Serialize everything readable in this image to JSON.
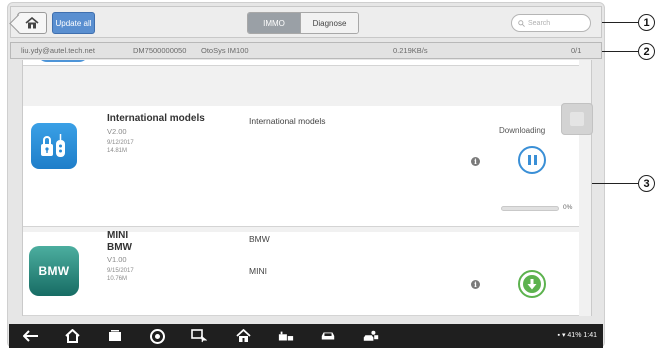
{
  "toolbar": {
    "home_icon": "home-icon",
    "update_all_label": "Update all",
    "tabs": [
      {
        "label": "IMMO",
        "active": true
      },
      {
        "label": "Diagnose",
        "active": false
      }
    ],
    "search_placeholder": "Search"
  },
  "info_bar": {
    "email": "liu.ydy@autel.tech.net",
    "serial": "DM7500000050",
    "system": "OtoSys IM100",
    "speed": "0.219KB/s",
    "count": "0/1"
  },
  "cards": [
    {
      "title": "International models",
      "version": "V2.00",
      "date": "9/12/2017",
      "size": "14.81M",
      "description": "International models",
      "status": "Downloading",
      "progress_pct": 0,
      "progress_label": "0%",
      "action_icon": "pause-icon"
    },
    {
      "title_line1": "MINI",
      "title_line2": "BMW",
      "version": "V1.00",
      "date": "9/15/2017",
      "size": "10.76M",
      "description_line1": "BMW",
      "description_line2": "MINI",
      "icon_text": "BMW",
      "action_icon": "download-icon"
    }
  ],
  "nav_icons": [
    "back-icon",
    "home-icon",
    "recent-apps-icon",
    "chrome-icon",
    "remote-icon",
    "autel-home-icon",
    "vci-icon",
    "car-icon",
    "user-car-icon"
  ],
  "system_status": "41% 1:41",
  "callouts": [
    "1",
    "2",
    "3"
  ],
  "colors": {
    "accent_blue": "#3a8fd6",
    "download_green": "#5cb24e",
    "update_button": "#5a8fd0",
    "navbar": "#1f1f1f"
  }
}
